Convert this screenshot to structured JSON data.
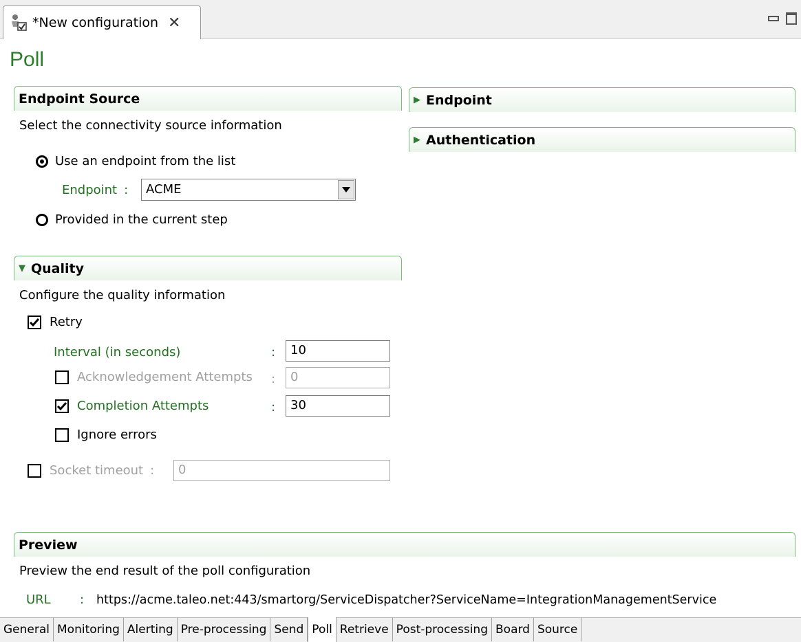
{
  "editor": {
    "tab_label": "*New configuration",
    "close_glyph": "✕"
  },
  "page": {
    "title": "Poll"
  },
  "endpoint_source": {
    "header": "Endpoint Source",
    "description": "Select the connectivity source information",
    "option_list": "Use an endpoint from the list",
    "endpoint_label": "Endpoint",
    "endpoint_value": "ACME",
    "option_step": "Provided in the current step",
    "selected_option": "list"
  },
  "endpoint_section": {
    "header": "Endpoint",
    "expanded": false
  },
  "authentication_section": {
    "header": "Authentication",
    "expanded": false
  },
  "quality": {
    "header": "Quality",
    "expanded": true,
    "description": "Configure the quality information",
    "retry_label": "Retry",
    "retry_checked": true,
    "interval_label": "Interval (in seconds)",
    "interval_value": "10",
    "ack_label": "Acknowledgement Attempts",
    "ack_checked": false,
    "ack_value": "0",
    "completion_label": "Completion Attempts",
    "completion_checked": true,
    "completion_value": "30",
    "ignore_label": "Ignore errors",
    "ignore_checked": false,
    "socket_label": "Socket timeout",
    "socket_checked": false,
    "socket_value": "0",
    "colon": ":"
  },
  "preview": {
    "header": "Preview",
    "description": "Preview the end result of the poll configuration",
    "url_label": "URL",
    "url_value": "https://acme.taleo.net:443/smartorg/ServiceDispatcher?ServiceName=IntegrationManagementService"
  },
  "page_tabs": [
    "General",
    "Monitoring",
    "Alerting",
    "Pre-processing",
    "Send",
    "Poll",
    "Retrieve",
    "Post-processing",
    "Board",
    "Source"
  ],
  "active_page_tab": "Poll",
  "colors": {
    "accent_green": "#237023",
    "section_border": "#7dbb7d",
    "disabled_grey": "#a0a0a0"
  }
}
